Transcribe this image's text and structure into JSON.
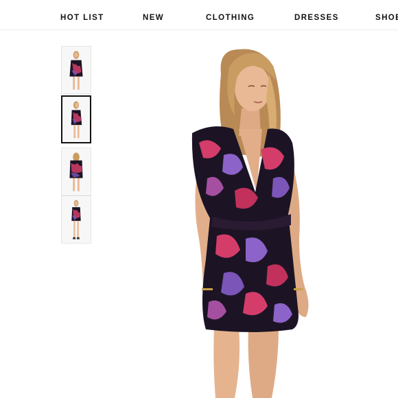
{
  "nav": {
    "items": [
      "HOT LIST",
      "NEW",
      "CLOTHING",
      "DRESSES",
      "SHOE"
    ]
  },
  "gallery": {
    "selected_index": 1,
    "thumbnails": [
      {
        "icon": "model-front-image"
      },
      {
        "icon": "model-side-image"
      },
      {
        "icon": "model-back-image"
      },
      {
        "icon": "model-full-length-image"
      }
    ]
  },
  "colors": {
    "nav_text": "#111111",
    "selected_border": "#111111",
    "dress_base": "#1c1425",
    "dress_pink": "#d43d6a",
    "dress_purple": "#7b55b8",
    "skin": "#e9b996",
    "hair": "#c99c62"
  }
}
